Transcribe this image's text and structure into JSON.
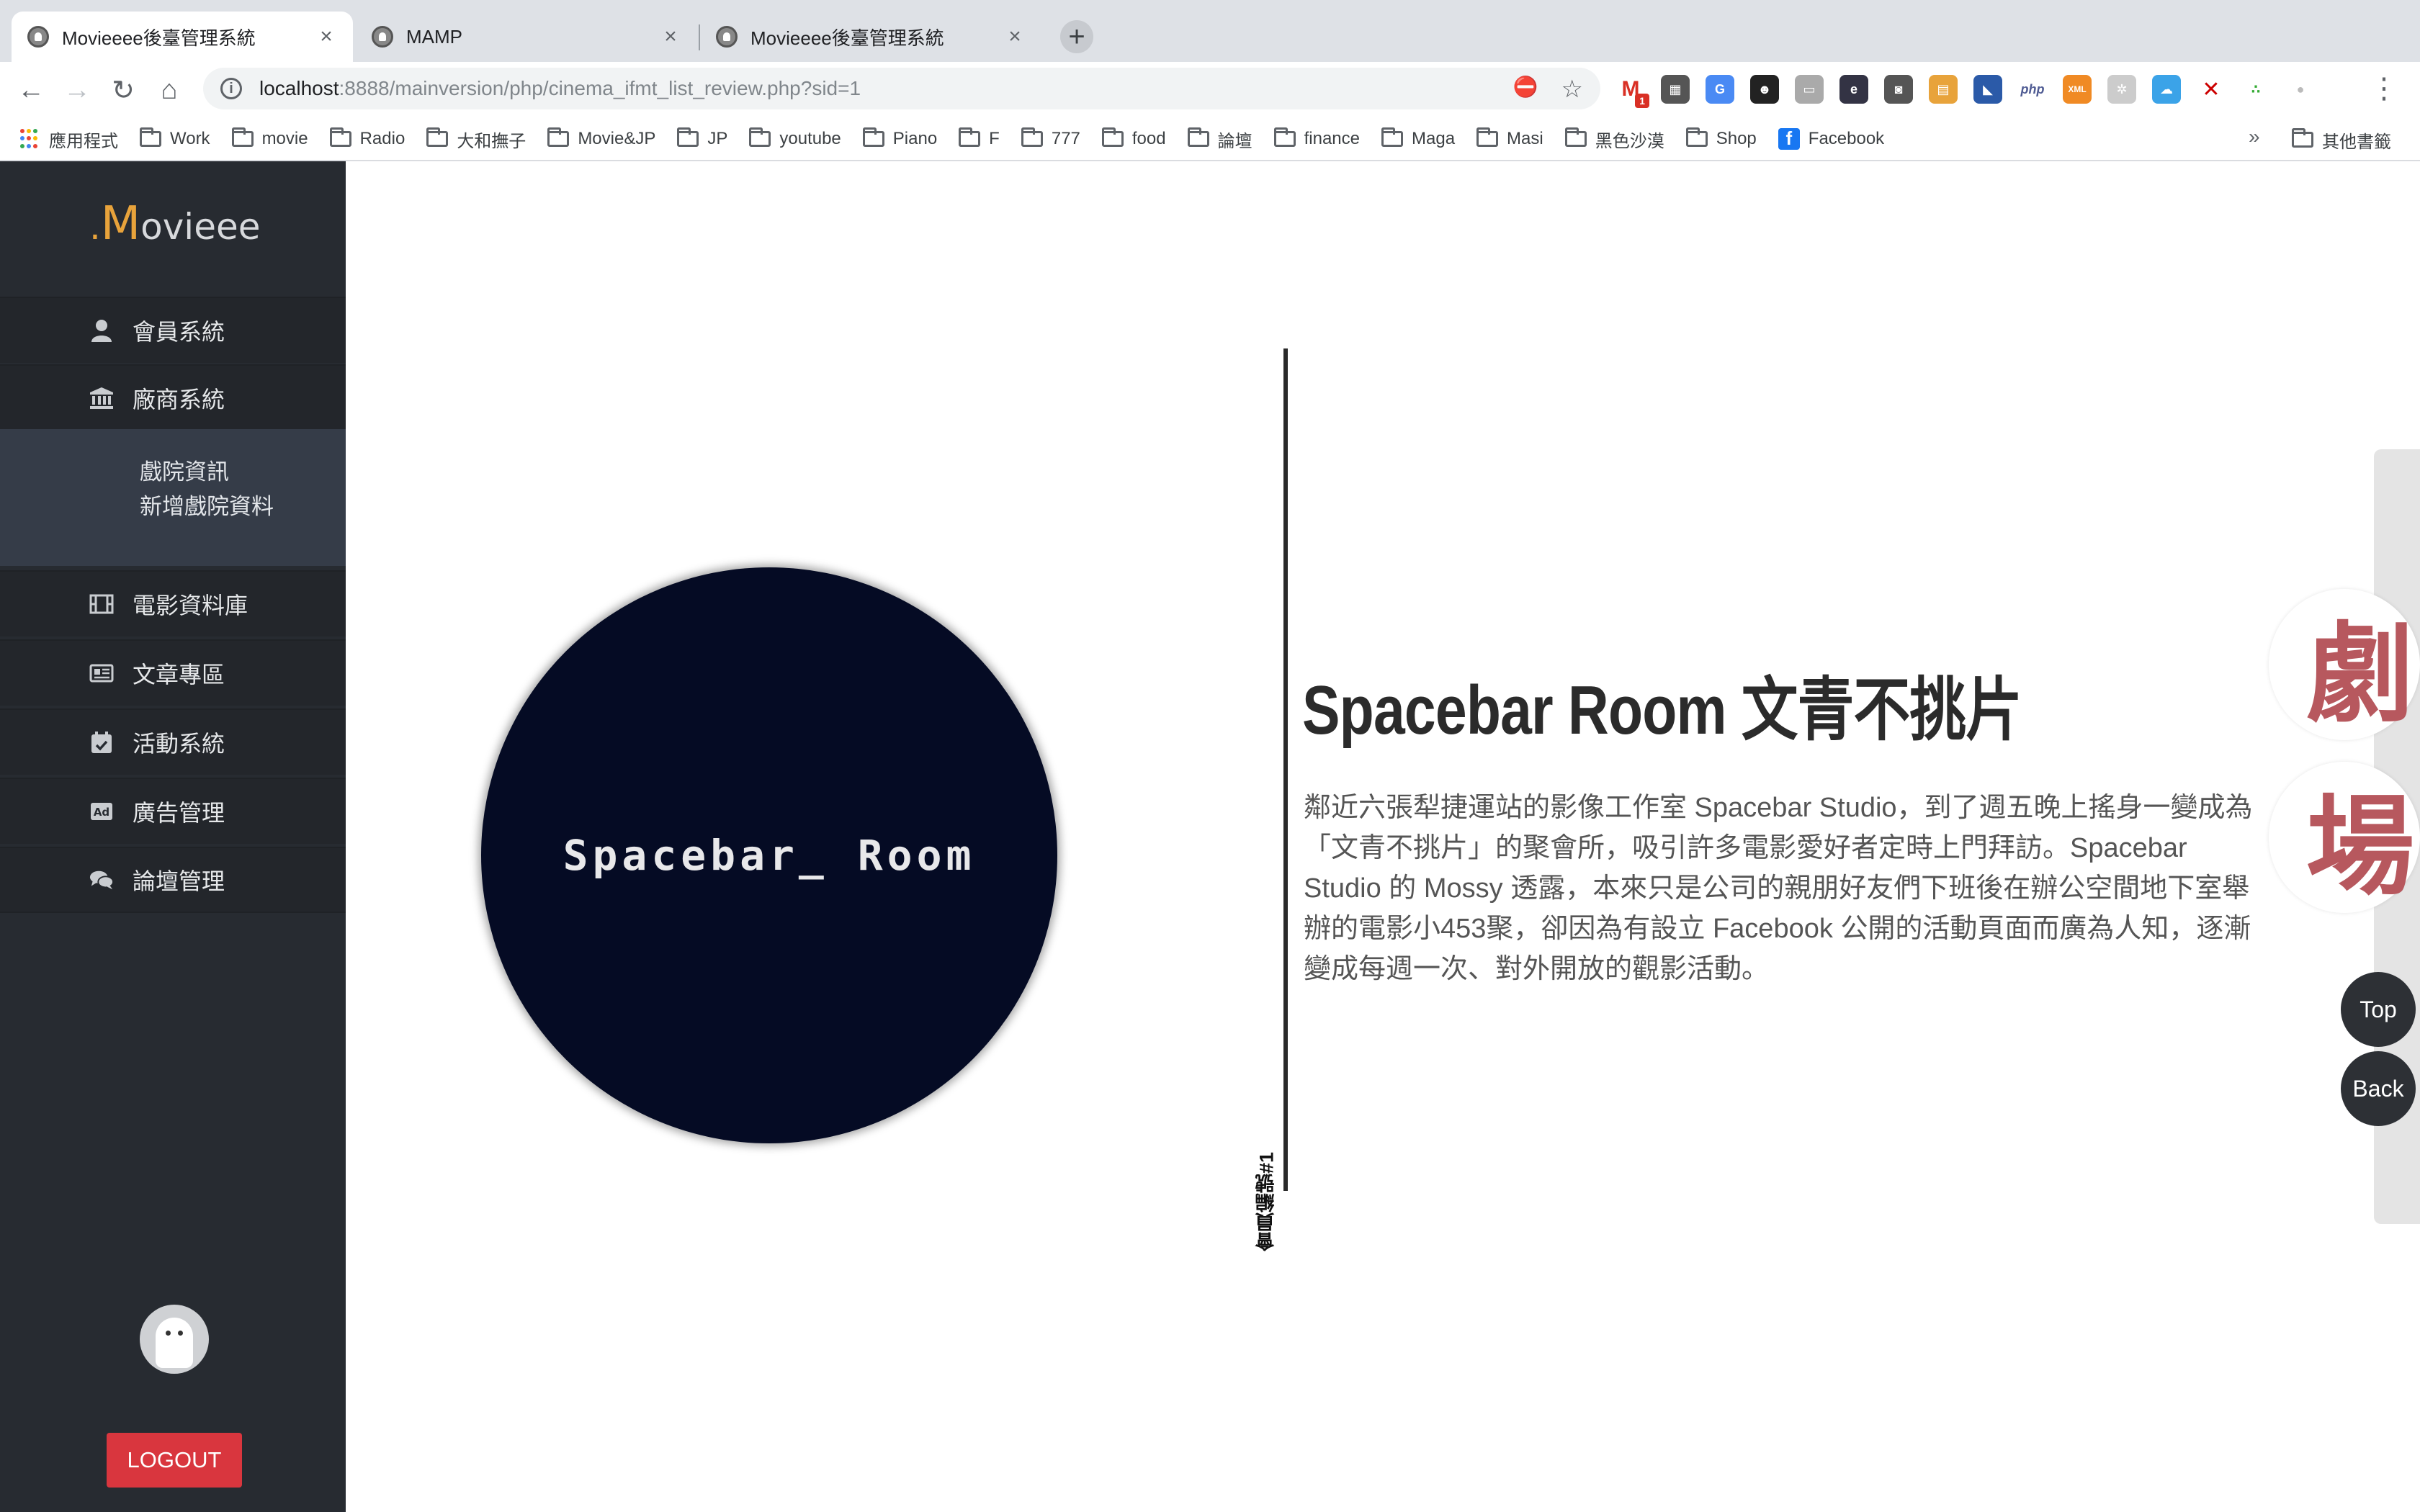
{
  "browser": {
    "tabs": [
      {
        "title": "Movieeee後臺管理系統"
      },
      {
        "title": "MAMP"
      },
      {
        "title": "Movieeee後臺管理系統"
      }
    ],
    "url_host": "localhost",
    "url_path": ":8888/mainversion/php/cinema_ifmt_list_review.php?sid=1",
    "bookmarks": [
      "應用程式",
      "Work",
      "movie",
      "Radio",
      "大和撫子",
      "Movie&JP",
      "JP",
      "youtube",
      "Piano",
      "F",
      "777",
      "food",
      "論壇",
      "finance",
      "Maga",
      "Masi",
      "黑色沙漠",
      "Shop",
      "Facebook"
    ],
    "bookmarks_more": "»",
    "other_bookmarks": "其他書籤",
    "gmail_badge": "1"
  },
  "sidebar": {
    "logo_dot": ".",
    "logo_m": "M",
    "logo_rest": "ovieee",
    "items": [
      {
        "label": "會員系統",
        "icon": "user-icon"
      },
      {
        "label": "廠商系統",
        "icon": "bank-icon"
      },
      {
        "label": "電影資料庫",
        "icon": "film-icon"
      },
      {
        "label": "文章專區",
        "icon": "newspaper-icon"
      },
      {
        "label": "活動系統",
        "icon": "calendar-check-icon"
      },
      {
        "label": "廣告管理",
        "icon": "ad-icon"
      },
      {
        "label": "論壇管理",
        "icon": "comments-icon"
      }
    ],
    "submenu": [
      "戲院資訊",
      "新增戲院資料"
    ],
    "logout": "LOGOUT"
  },
  "main": {
    "logo_text": "Spacebar_ Room",
    "member_no": "會員編號#1",
    "title": "Spacebar Room 文青不挑片",
    "description": "鄰近六張犁捷運站的影像工作室 Spacebar Studio，到了週五晚上搖身一變成為「文青不挑片」的聚會所，吸引許多電影愛好者定時上門拜訪。Spacebar Studio 的 Mossy 透露，本來只是公司的親朋好友們下班後在辦公空間地下室舉辦的電影小453聚，卻因為有設立 Facebook 公開的活動頁面而廣為人知，逐漸變成每週一次、對外開放的觀影活動。",
    "side_chars": [
      "劇",
      "場"
    ],
    "top_btn": "Top",
    "back_btn": "Back"
  },
  "colors": {
    "accent": "#e8a33b",
    "sidebar_bg": "#272b31",
    "logout": "#d9363e",
    "side_char": "#b7585e"
  }
}
